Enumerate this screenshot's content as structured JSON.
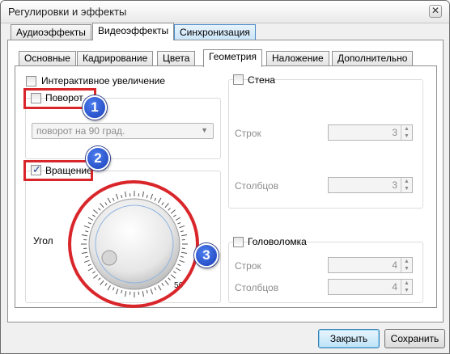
{
  "window": {
    "title": "Регулировки и эффекты",
    "close_glyph": "✕"
  },
  "top_tabs": [
    "Аудиоэффекты",
    "Видеоэффекты",
    "Синхронизация"
  ],
  "sub_tabs": [
    "Основные",
    "Кадрирование",
    "Цвета",
    "Геометрия",
    "Наложение",
    "Дополнительно"
  ],
  "geometry": {
    "interactive_zoom": "Интерактивное увеличение",
    "rotate": "Поворот",
    "rotate_select": "поворот на 90 град.",
    "rotation": "Вращение",
    "angle_label": "Угол",
    "angle_value": "56",
    "wall": "Стена",
    "wall_rows_label": "Строк",
    "wall_rows_value": "3",
    "wall_cols_label": "Столбцов",
    "wall_cols_value": "3",
    "puzzle": "Головоломка",
    "puzzle_rows_label": "Строк",
    "puzzle_rows_value": "4",
    "puzzle_cols_label": "Столбцов",
    "puzzle_cols_value": "4"
  },
  "checks": {
    "interactive_zoom": false,
    "rotate": false,
    "rotation": true,
    "wall": false,
    "puzzle": false
  },
  "badges": [
    "1",
    "2",
    "3"
  ],
  "buttons": {
    "close": "Закрыть",
    "save": "Сохранить"
  },
  "colors": {
    "marker_red": "#d9262b",
    "badge_blue": "#1b3fb8"
  }
}
